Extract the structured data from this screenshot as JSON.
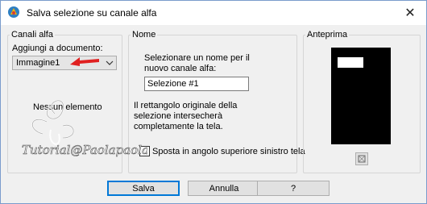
{
  "window": {
    "title": "Salva selezione su canale alfa",
    "close_symbol": "✕"
  },
  "canali": {
    "legend": "Canali alfa",
    "add_to_label": "Aggiungi a documento:",
    "document_value": "Immagine1",
    "empty_text": "Nessun elemento"
  },
  "nome": {
    "legend": "Nome",
    "instruction_line1": "Selezionare un nome per il",
    "instruction_line2": "nuovo canale alfa:",
    "name_value": "Selezione #1",
    "note_line1": "Il rettangolo originale della",
    "note_line2": "selezione intersecherà",
    "note_line3": "completamente la tela.",
    "checkbox_label": "Sposta in angolo superiore sinistro tela",
    "checkbox_checked": false
  },
  "anteprima": {
    "legend": "Anteprima"
  },
  "buttons": {
    "save": "Salva",
    "cancel": "Annulla",
    "help": "?"
  },
  "watermark": {
    "text": "Tutorial@Paolapaola"
  },
  "colors": {
    "accent": "#0078d7",
    "annotation_arrow": "#e02020"
  },
  "icons": {
    "app": "app-icon",
    "dropdown": "chevron-down-icon",
    "zoom": "zoom-icon",
    "arrow": "arrow-icon"
  }
}
